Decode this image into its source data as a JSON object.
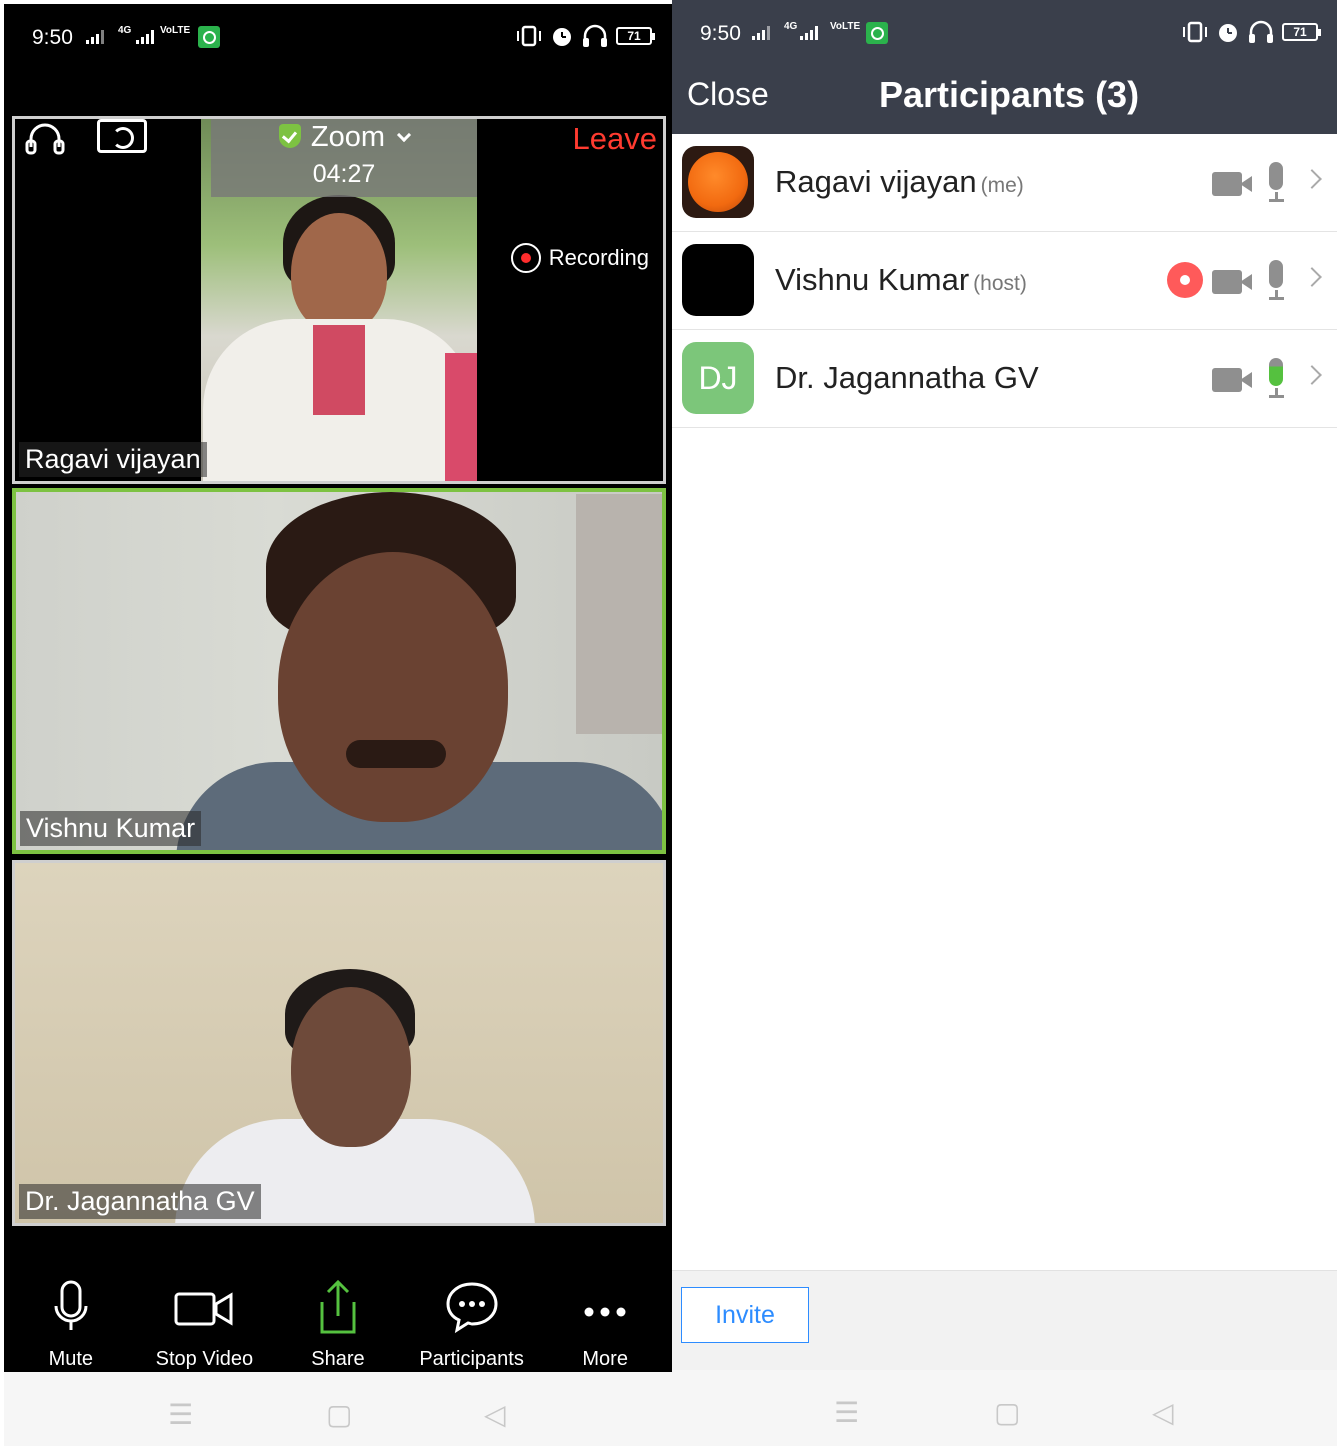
{
  "status_bar": {
    "time": "9:50",
    "network": "4G",
    "volte": "VoLTE",
    "battery": "71"
  },
  "meeting": {
    "title": "Zoom",
    "timer": "04:27",
    "leave_label": "Leave",
    "recording_label": "Recording",
    "tiles": [
      {
        "name": "Ragavi vijayan"
      },
      {
        "name": "Vishnu Kumar"
      },
      {
        "name": "Dr. Jagannatha GV"
      }
    ],
    "toolbar": [
      {
        "label": "Mute",
        "icon": "microphone-icon"
      },
      {
        "label": "Stop Video",
        "icon": "video-camera-icon"
      },
      {
        "label": "Share",
        "icon": "share-icon"
      },
      {
        "label": "Participants",
        "icon": "chat-bubble-icon"
      },
      {
        "label": "More",
        "icon": "more-dots-icon"
      }
    ]
  },
  "participants_panel": {
    "close_label": "Close",
    "title": "Participants (3)",
    "participants": [
      {
        "name": "Ragavi vijayan",
        "tag": "(me)",
        "mic_active": false,
        "recording": false
      },
      {
        "name": "Vishnu Kumar",
        "tag": "(host)",
        "mic_active": false,
        "recording": true
      },
      {
        "name": "Dr. Jagannatha GV",
        "tag": "",
        "initials": "DJ",
        "mic_active": true,
        "recording": false
      }
    ],
    "invite_label": "Invite"
  },
  "colors": {
    "active_speaker_border": "#7dc242",
    "leave": "#ff3b30",
    "panel_header": "#3a3f4b",
    "invite_blue": "#2d8cff",
    "avatar_dj": "#7cc67a"
  }
}
